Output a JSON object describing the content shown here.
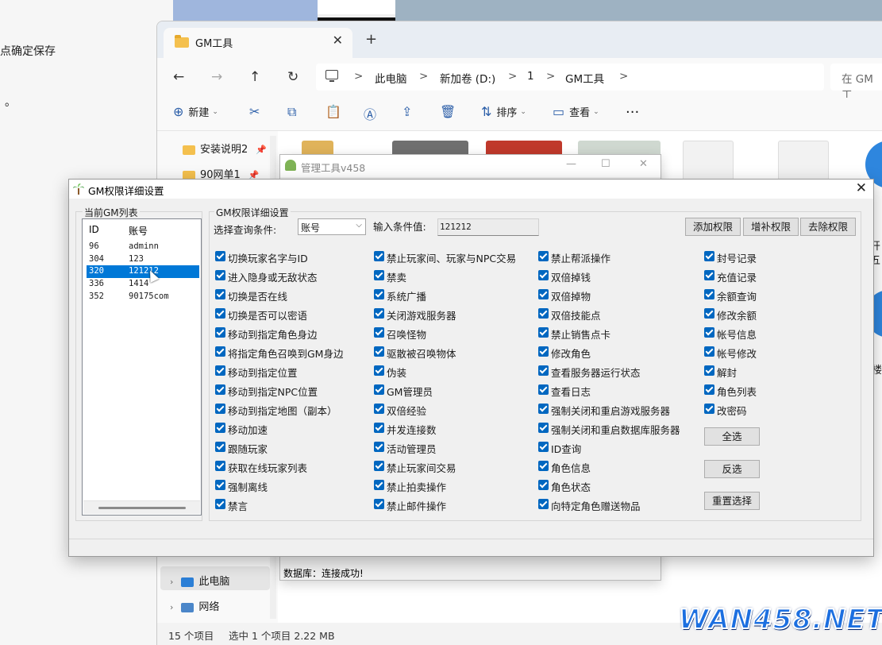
{
  "background_doc": {
    "line1": "点确定保存",
    "line2": "。"
  },
  "explorer": {
    "tab_title": "GM工具",
    "tab_close": "✕",
    "new_tab": "+",
    "nav": {
      "back": "←",
      "forward": "→",
      "up": "↑",
      "refresh": "↻"
    },
    "breadcrumb": [
      "此电脑",
      "新加卷 (D:)",
      "1",
      "GM工具"
    ],
    "breadcrumb_sep": ">",
    "search_placeholder": "在 GM工",
    "toolbar": {
      "new": "新建",
      "sort": "排序",
      "view": "查看",
      "more": "···"
    },
    "nav_items": [
      {
        "label": "安装说明2",
        "pin": "📌"
      },
      {
        "label": "90网单1",
        "pin": "📌"
      }
    ],
    "nav_tree": [
      {
        "label": "此电脑"
      },
      {
        "label": "网络"
      }
    ],
    "status_count": "15 个项目",
    "status_selected": "选中 1 个项目  2.22 MB",
    "right_edge_text": [
      "开",
      "五",
      "楼"
    ]
  },
  "manage_tool": {
    "title": "管理工具v458",
    "min": "—",
    "max": "☐",
    "close": "✕",
    "status": "数据库：连接成功!"
  },
  "dialog": {
    "title": "GM权限详细设置",
    "close": "✕",
    "left_group": "当前GM列表",
    "list_headers": {
      "id": "ID",
      "account": "账号"
    },
    "accounts": [
      {
        "id": "96",
        "account": "adminn",
        "selected": false
      },
      {
        "id": "304",
        "account": "123",
        "selected": false
      },
      {
        "id": "320",
        "account": "121212",
        "selected": true
      },
      {
        "id": "336",
        "account": "1414",
        "selected": false
      },
      {
        "id": "352",
        "account": "90175com",
        "selected": false
      }
    ],
    "right_group": "GM权限详细设置",
    "query_label": "选择查询条件:",
    "query_value": "账号",
    "input_label": "输入条件值:",
    "input_value": "121212",
    "buttons": {
      "add": "添加权限",
      "supplement": "增补权限",
      "remove": "去除权限",
      "select_all": "全选",
      "invert": "反选",
      "reset": "重置选择"
    },
    "permissions": {
      "col1": [
        "切换玩家名字与ID",
        "进入隐身或无敌状态",
        "切换是否在线",
        "切换是否可以密语",
        "移动到指定角色身边",
        "将指定角色召唤到GM身边",
        "移动到指定位置",
        "移动到指定NPC位置",
        "移动到指定地图（副本）",
        "移动加速",
        "跟随玩家",
        "获取在线玩家列表",
        "强制离线",
        "禁言"
      ],
      "col2": [
        "禁止玩家间、玩家与NPC交易",
        "禁卖",
        "系统广播",
        "关闭游戏服务器",
        "召唤怪物",
        "驱散被召唤物体",
        "伪装",
        "GM管理员",
        "双倍经验",
        "并发连接数",
        "活动管理员",
        "禁止玩家间交易",
        "禁止拍卖操作",
        "禁止邮件操作"
      ],
      "col3": [
        "禁止帮派操作",
        "双倍掉钱",
        "双倍掉物",
        "双倍技能点",
        "禁止销售点卡",
        "修改角色",
        "查看服务器运行状态",
        "查看日志",
        "强制关闭和重启游戏服务器",
        "强制关闭和重启数据库服务器",
        "ID查询",
        "角色信息",
        "角色状态",
        "向特定角色赠送物品"
      ],
      "col4": [
        "封号记录",
        "充值记录",
        "余额查询",
        "修改余额",
        "帐号信息",
        "帐号修改",
        "解封",
        "角色列表",
        "改密码"
      ]
    }
  },
  "watermark": "WAN458.NET",
  "colors": {
    "accent": "#0078d7",
    "checkbox": "#0067c0",
    "watermark": "#1c6fe0"
  }
}
